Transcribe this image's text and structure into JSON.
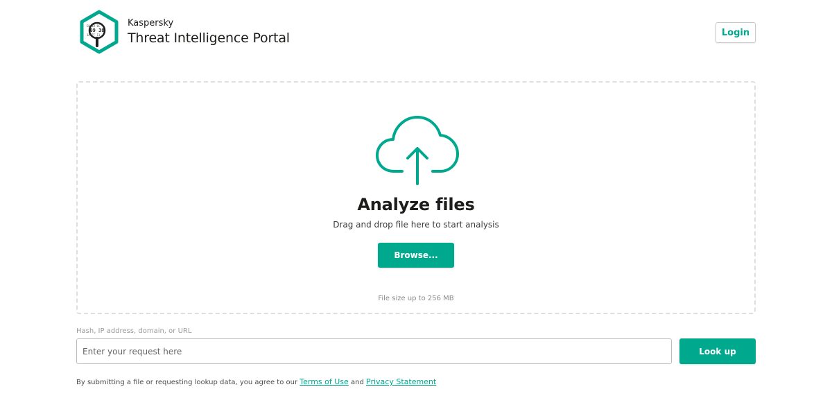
{
  "header": {
    "company": "Kaspersky",
    "product": "Threat Intelligence Portal",
    "login_label": "Login",
    "logo_text": "09 38"
  },
  "dropzone": {
    "title": "Analyze files",
    "subtitle": "Drag and drop file here to start analysis",
    "browse_label": "Browse...",
    "limit_text": "File size up to 256 MB",
    "icon": "cloud-upload-icon"
  },
  "lookup": {
    "label": "Hash, IP address, domain, or URL",
    "placeholder": "Enter your request here",
    "value": "",
    "button_label": "Look up"
  },
  "legal": {
    "prefix": "By submitting a file or requesting lookup data, you agree to our",
    "terms_label": "Terms of Use",
    "conjunction": "and",
    "privacy_label": "Privacy Statement"
  },
  "colors": {
    "accent": "#00a88e",
    "text": "#1d1d1b",
    "border": "#dedede"
  }
}
